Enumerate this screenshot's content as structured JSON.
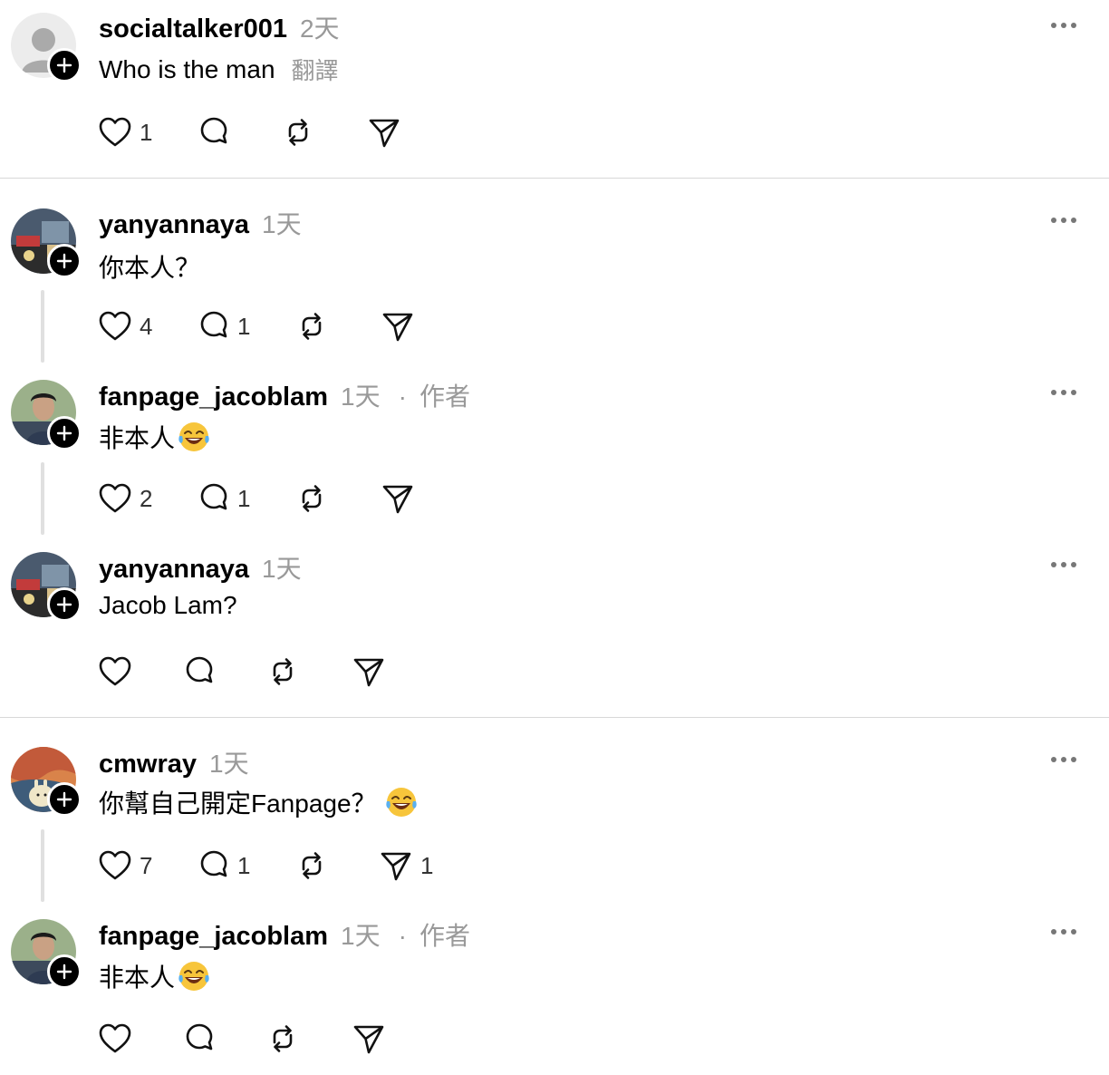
{
  "comments": [
    {
      "username": "socialtalker001",
      "time": "2天",
      "author_tag": "",
      "text": "Who is the man",
      "translate": "翻譯",
      "likes": "1",
      "replies": "",
      "reposts": "",
      "shares": "",
      "emoji": false
    },
    {
      "username": "yanyannaya",
      "time": "1天",
      "author_tag": "",
      "text": "你本人？",
      "translate": "",
      "likes": "4",
      "replies": "1",
      "reposts": "",
      "shares": "",
      "emoji": false
    },
    {
      "username": "fanpage_jacoblam",
      "time": "1天",
      "author_tag": "作者",
      "text": "非本人",
      "translate": "",
      "likes": "2",
      "replies": "1",
      "reposts": "",
      "shares": "",
      "emoji": true
    },
    {
      "username": "yanyannaya",
      "time": "1天",
      "author_tag": "",
      "text": "Jacob Lam?",
      "translate": "",
      "likes": "",
      "replies": "",
      "reposts": "",
      "shares": "",
      "emoji": false
    },
    {
      "username": "cmwray",
      "time": "1天",
      "author_tag": "",
      "text": "你幫自己開定Fanpage？",
      "translate": "",
      "likes": "7",
      "replies": "1",
      "reposts": "",
      "shares": "1",
      "emoji": true
    },
    {
      "username": "fanpage_jacoblam",
      "time": "1天",
      "author_tag": "作者",
      "text": "非本人",
      "translate": "",
      "likes": "",
      "replies": "",
      "reposts": "",
      "shares": "",
      "emoji": true
    }
  ],
  "separator_dot": "·",
  "icons": {
    "like": "heart-icon",
    "reply": "comment-bubble-icon",
    "repost": "repost-icon",
    "share": "send-icon",
    "more": "more-dots-icon",
    "follow": "plus-icon",
    "emoji": "laughing-tears-emoji"
  },
  "colors": {
    "text": "#000000",
    "meta": "#999999",
    "divider": "#d8d8d8",
    "thread_line": "#e0e0e0"
  }
}
